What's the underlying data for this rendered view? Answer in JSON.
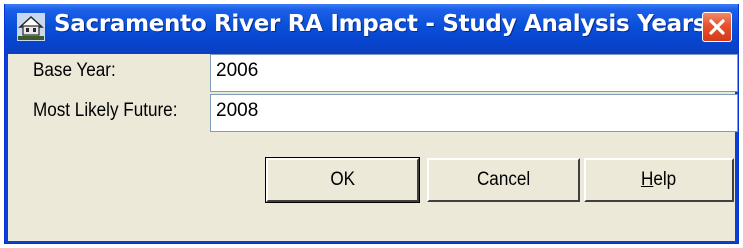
{
  "window": {
    "title": "Sacramento River RA Impact - Study Analysis Years",
    "close_icon": "close-icon",
    "app_icon": "building-icon"
  },
  "form": {
    "base_year_label": "Base Year:",
    "base_year_value": "2006",
    "most_likely_future_label": "Most Likely Future:",
    "most_likely_future_value": "2008"
  },
  "buttons": {
    "ok_label": "OK",
    "cancel_label": "Cancel",
    "help_label": "Help"
  }
}
